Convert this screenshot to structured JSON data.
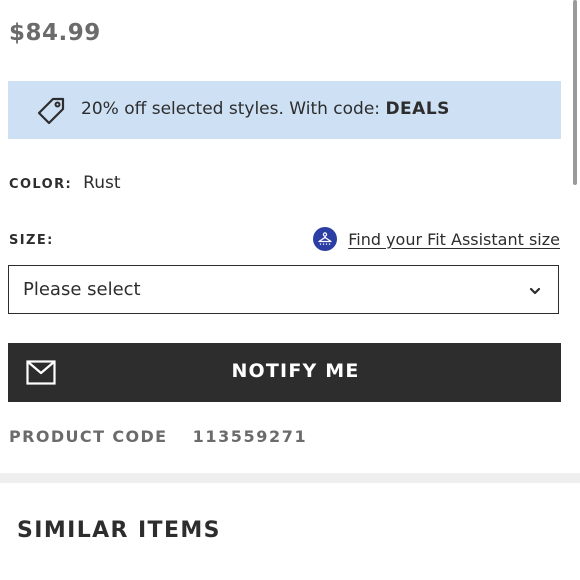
{
  "price": "$84.99",
  "promo": {
    "text": "20% off selected styles. With code: ",
    "code": "DEALS",
    "icon": "tag-icon"
  },
  "color": {
    "label": "COLOR:",
    "value": "Rust"
  },
  "size": {
    "label": "SIZE:",
    "fit_link": "Find your Fit Assistant size",
    "fit_icon": "hanger-icon",
    "select_value": "Please select"
  },
  "notify": {
    "label": "NOTIFY ME",
    "icon": "mail-icon"
  },
  "product_code": {
    "label": "PRODUCT CODE",
    "value": "113559271"
  },
  "similar_items": {
    "title": "SIMILAR ITEMS"
  },
  "colors": {
    "promo_bg": "#cde0f4",
    "button_bg": "#2d2d2d",
    "fit_icon_bg": "#2b3ea3",
    "muted_text": "#6b6b6b"
  }
}
